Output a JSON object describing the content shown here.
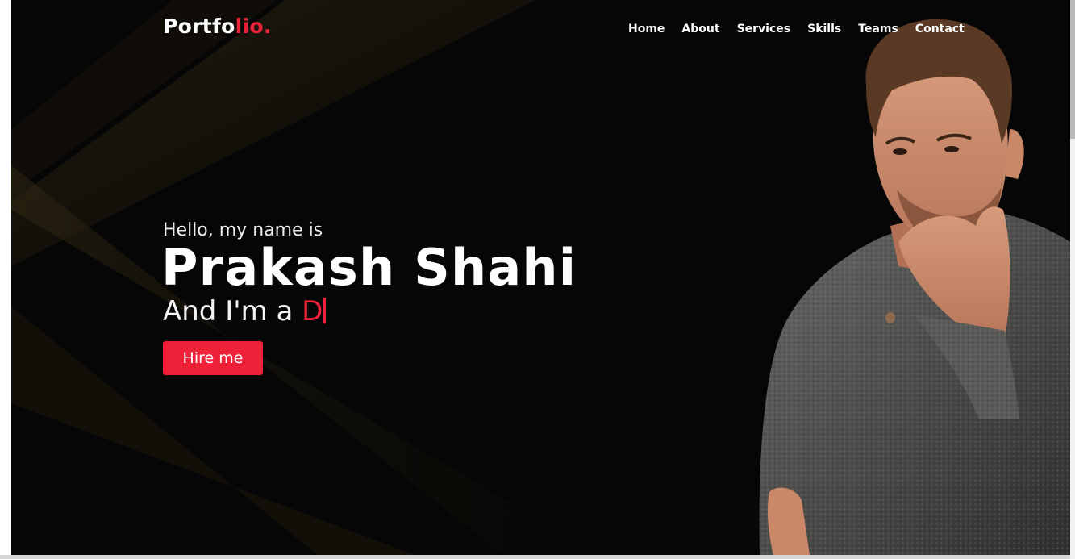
{
  "brand": {
    "logo_main": "Portfo",
    "logo_accent": "lio.",
    "accent_color": "#ee2139"
  },
  "nav": {
    "items": [
      {
        "label": "Home"
      },
      {
        "label": "About"
      },
      {
        "label": "Services"
      },
      {
        "label": "Skills"
      },
      {
        "label": "Teams"
      },
      {
        "label": "Contact"
      }
    ]
  },
  "hero": {
    "greeting": "Hello, my name is",
    "name": "Prakash Shahi",
    "role_prefix": "And I'm a",
    "role_typed": "D",
    "cta_label": "Hire me",
    "portrait_icon": "man-portrait-photo"
  }
}
